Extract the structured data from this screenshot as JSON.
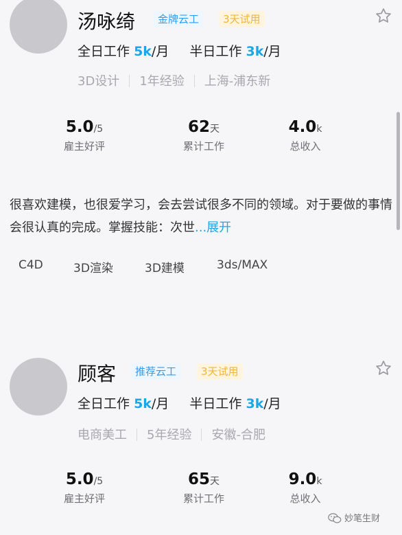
{
  "cards": [
    {
      "name": "汤咏绮",
      "badge_primary": "金牌云工",
      "badge_trial": "3天试用",
      "salary": {
        "full_label": "全日工作",
        "full_value": "5k",
        "full_unit": "/月",
        "half_label": "半日工作",
        "half_value": "3k",
        "half_unit": "/月"
      },
      "tags": [
        "3D设计",
        "1年经验",
        "上海-浦东新"
      ],
      "stats": [
        {
          "value": "5.0",
          "unit": "/5",
          "label": "雇主好评"
        },
        {
          "value": "62",
          "unit": "天",
          "label": "累计工作"
        },
        {
          "value": "4.0",
          "unit": "k",
          "label": "总收入"
        }
      ],
      "bio": "很喜欢建模，也很爱学习，会去尝试很多不同的领域。对于要做的事情会很认真的完成。掌握技能：次世",
      "bio_expand": "...展开",
      "skills": [
        "C4D",
        "3D渲染",
        "3D建模",
        "3ds/MAX"
      ]
    },
    {
      "name": "顾客",
      "badge_primary": "推荐云工",
      "badge_trial": "3天试用",
      "salary": {
        "full_label": "全日工作",
        "full_value": "5k",
        "full_unit": "/月",
        "half_label": "半日工作",
        "half_value": "3k",
        "half_unit": "/月"
      },
      "tags": [
        "电商美工",
        "5年经验",
        "安徽-合肥"
      ],
      "stats": [
        {
          "value": "5.0",
          "unit": "/5",
          "label": "雇主好评"
        },
        {
          "value": "65",
          "unit": "天",
          "label": "累计工作"
        },
        {
          "value": "9.0",
          "unit": "k",
          "label": "总收入"
        }
      ]
    }
  ],
  "watermark": "妙笔生财",
  "icons": {
    "favorite": "star-outline-icon",
    "watermark": "wechat-icon"
  },
  "colors": {
    "accent": "#1aa7e8",
    "gold_badge_bg": "#eef6ff",
    "gold_badge_text": "#2f9df3",
    "trial_badge_bg": "#fff5de",
    "trial_badge_text": "#f1b53a"
  }
}
